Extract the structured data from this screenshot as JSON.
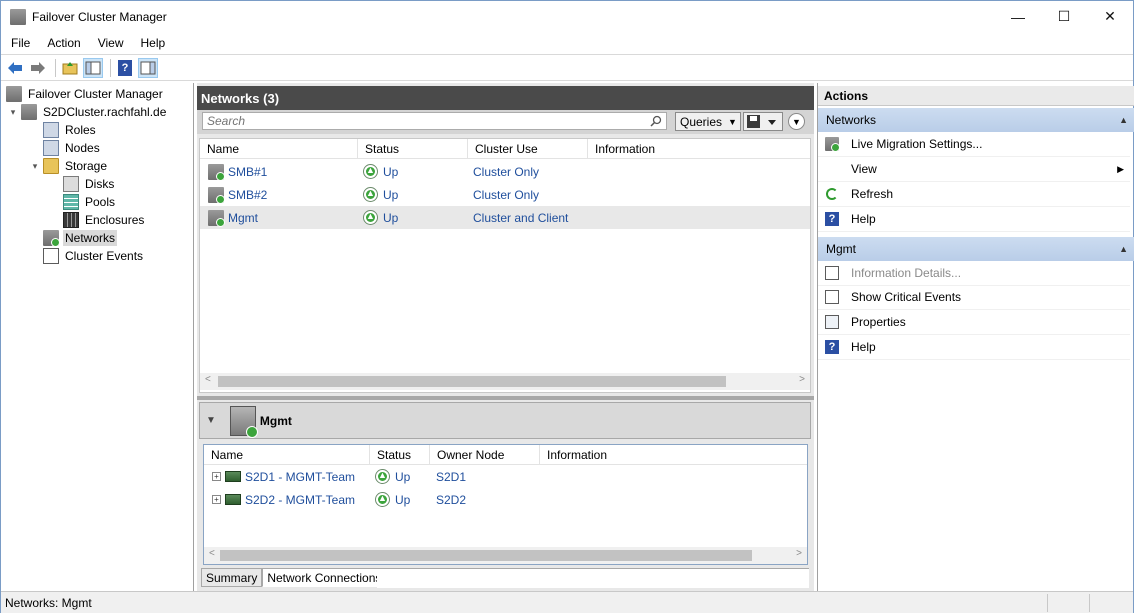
{
  "window": {
    "title": "Failover Cluster Manager",
    "controls": {
      "minimize": "—",
      "maximize": "☐",
      "close": "✕"
    }
  },
  "menu": [
    "File",
    "Action",
    "View",
    "Help"
  ],
  "toolbar": {
    "icons": [
      "back-icon",
      "forward-icon",
      "up-folder-icon",
      "show-hide-tree-icon",
      "help-icon",
      "show-hide-action-pane-icon"
    ]
  },
  "tree": {
    "items": [
      {
        "label": "Failover Cluster Manager",
        "icon": "cluster-manager-icon",
        "expander": ""
      },
      {
        "label": "S2DCluster.rachfahl.de",
        "icon": "cluster-icon",
        "expander": "▾"
      },
      {
        "label": "Roles",
        "icon": "roles-icon",
        "expander": ""
      },
      {
        "label": "Nodes",
        "icon": "nodes-icon",
        "expander": ""
      },
      {
        "label": "Storage",
        "icon": "folder-icon",
        "expander": "▾"
      },
      {
        "label": "Disks",
        "icon": "disks-icon",
        "expander": ""
      },
      {
        "label": "Pools",
        "icon": "pools-icon",
        "expander": ""
      },
      {
        "label": "Enclosures",
        "icon": "enclosures-icon",
        "expander": ""
      },
      {
        "label": "Networks",
        "icon": "networks-icon",
        "expander": "",
        "selected": true
      },
      {
        "label": "Cluster Events",
        "icon": "cluster-events-icon",
        "expander": ""
      }
    ]
  },
  "center": {
    "title": "Networks (3)",
    "search": {
      "placeholder": "Search",
      "value": ""
    },
    "queries_label": "Queries",
    "columns": [
      "Name",
      "Status",
      "Cluster Use",
      "Information"
    ],
    "rows": [
      {
        "name": "SMB#1",
        "status": "Up",
        "cluster_use": "Cluster Only",
        "information": ""
      },
      {
        "name": "SMB#2",
        "status": "Up",
        "cluster_use": "Cluster Only",
        "information": ""
      },
      {
        "name": "Mgmt",
        "status": "Up",
        "cluster_use": "Cluster and Client",
        "information": "",
        "selected": true
      }
    ],
    "detail": {
      "title": "Mgmt",
      "columns": [
        "Name",
        "Status",
        "Owner Node",
        "Information"
      ],
      "rows": [
        {
          "name": "S2D1 - MGMT-Team",
          "status": "Up",
          "owner_node": "S2D1",
          "information": ""
        },
        {
          "name": "S2D2 - MGMT-Team",
          "status": "Up",
          "owner_node": "S2D2",
          "information": ""
        }
      ],
      "tabs": [
        "Summary",
        "Network Connections"
      ],
      "active_tab": "Network Connections"
    }
  },
  "actions": {
    "title": "Actions",
    "sections": [
      {
        "title": "Networks",
        "items": [
          {
            "label": "Live Migration Settings...",
            "icon": "live-migration-icon"
          },
          {
            "label": "View",
            "icon": "",
            "submenu": "▶"
          },
          {
            "label": "Refresh",
            "icon": "refresh-icon"
          },
          {
            "label": "Help",
            "icon": "help-icon"
          }
        ]
      },
      {
        "title": "Mgmt",
        "items": [
          {
            "label": "Information Details...",
            "icon": "information-details-icon",
            "disabled": true
          },
          {
            "label": "Show Critical Events",
            "icon": "critical-events-icon"
          },
          {
            "label": "Properties",
            "icon": "properties-icon"
          },
          {
            "label": "Help",
            "icon": "help-icon"
          }
        ]
      }
    ]
  },
  "status_bar": {
    "text": "Networks:  Mgmt"
  },
  "colors": {
    "accent_section": "#c3d5ee",
    "header_dark": "#4a4a4a",
    "link_blue": "#1f4e9c",
    "status_green": "#3ca43c"
  }
}
